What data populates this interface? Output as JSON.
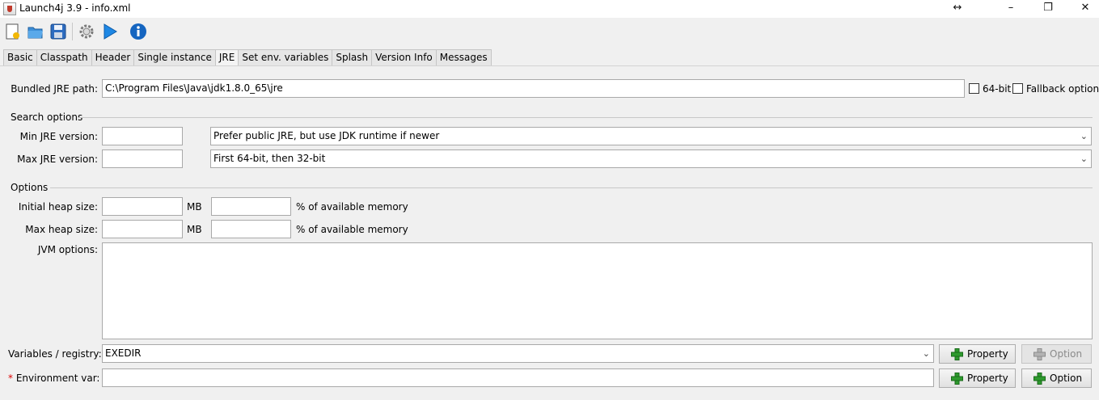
{
  "window": {
    "title": "Launch4j 3.9 - info.xml",
    "controls": {
      "resize": "↔",
      "minimize": "–",
      "maximize": "❐",
      "close": "✕"
    }
  },
  "toolbar": {
    "icons": [
      "new-config-icon",
      "open-folder-icon",
      "save-icon",
      "build-gear-icon",
      "run-play-icon",
      "info-icon"
    ]
  },
  "tabs": [
    {
      "label": "Basic"
    },
    {
      "label": "Classpath"
    },
    {
      "label": "Header"
    },
    {
      "label": "Single instance"
    },
    {
      "label": "JRE",
      "active": true
    },
    {
      "label": "Set env. variables"
    },
    {
      "label": "Splash"
    },
    {
      "label": "Version Info"
    },
    {
      "label": "Messages"
    }
  ],
  "jre": {
    "bundled_label": "Bundled JRE path:",
    "bundled_value": "C:\\Program Files\\Java\\jdk1.8.0_65\\jre",
    "bit64_label": "64-bit",
    "bit64_checked": false,
    "fallback_label": "Fallback option",
    "fallback_checked": false
  },
  "search_options": {
    "title": "Search options",
    "min_label": "Min JRE version:",
    "min_value": "",
    "max_label": "Max JRE version:",
    "max_value": "",
    "jdk_preference": "Prefer public JRE, but use JDK runtime if newer",
    "runtime_bits": "First 64-bit, then 32-bit"
  },
  "options": {
    "title": "Options",
    "initial_heap_label": "Initial heap size:",
    "max_heap_label": "Max heap size:",
    "mb": "MB",
    "percent": "% of available memory",
    "initial_heap_mb": "",
    "initial_heap_percent": "",
    "max_heap_mb": "",
    "max_heap_percent": "",
    "jvm_label": "JVM options:",
    "jvm_value": ""
  },
  "variables": {
    "label": "Variables / registry:",
    "value": "EXEDIR",
    "property_btn": "Property",
    "option_btn": "Option"
  },
  "env": {
    "required_mark": "*",
    "label": " Environment var:",
    "value": "",
    "property_btn": "Property",
    "option_btn": "Option"
  },
  "colors": {
    "plus_green": "#2e9a2e",
    "disabled_gray": "#9a9a9a",
    "accent_blue": "#1565c0"
  }
}
